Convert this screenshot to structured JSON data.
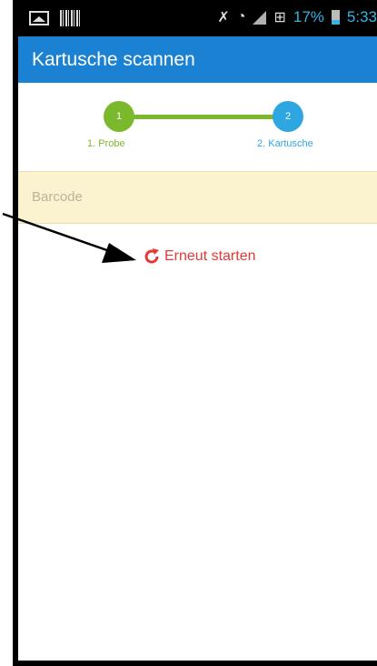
{
  "status_bar": {
    "battery_percent": "17%",
    "time": "5:33"
  },
  "app_bar": {
    "title": "Kartusche scannen"
  },
  "stepper": {
    "steps": [
      {
        "number": "1",
        "label": "1. Probe",
        "color": "#7ab82c"
      },
      {
        "number": "2",
        "label": "2. Kartusche",
        "color": "#2ea6e0"
      }
    ],
    "line_color": "#7ab82c"
  },
  "barcode": {
    "placeholder": "Barcode"
  },
  "restart": {
    "label": "Erneut starten",
    "color": "#e53935"
  },
  "icons": {
    "status_left": [
      "image-icon",
      "barcode-icon"
    ],
    "status_right": [
      "mute-icon",
      "wifi-icon",
      "signal-icon",
      "network-icon",
      "battery-icon"
    ],
    "restart": "refresh-icon"
  }
}
